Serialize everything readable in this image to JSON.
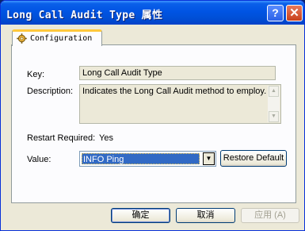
{
  "window": {
    "title": "Long Call Audit Type 属性",
    "help_glyph": "?",
    "close_glyph": "✕"
  },
  "tab": {
    "label": "Configuration"
  },
  "fields": {
    "key_label": "Key:",
    "key_value": "Long Call Audit Type",
    "description_label": "Description:",
    "description_value": "Indicates the Long Call Audit method to employ.",
    "restart_label": "Restart Required:",
    "restart_value": "Yes",
    "value_label": "Value:",
    "value_selected": "INFO Ping",
    "restore_default": "Restore Default"
  },
  "buttons": {
    "ok": "确定",
    "cancel": "取消",
    "apply": "应用 (A)"
  }
}
